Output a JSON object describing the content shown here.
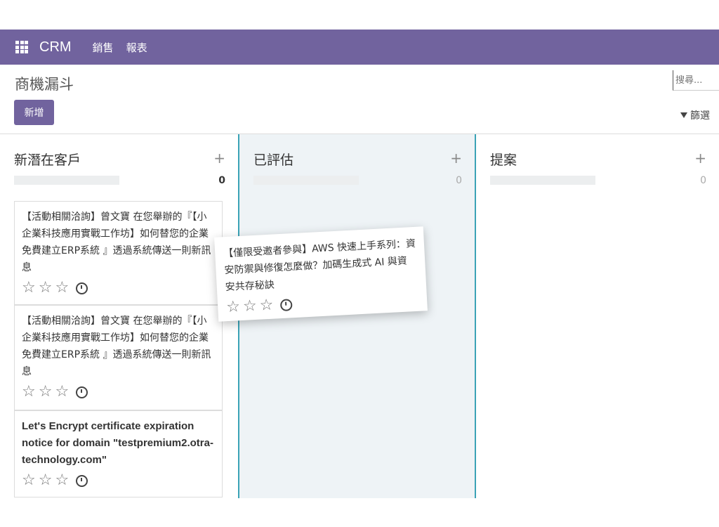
{
  "topbar": {
    "app_name": "CRM",
    "menu": [
      "銷售",
      "報表"
    ]
  },
  "control_panel": {
    "page_title": "商機漏斗",
    "new_button": "新增",
    "search_placeholder": "搜尋...",
    "filter_label": "篩選"
  },
  "columns": [
    {
      "title": "新潛在客戶",
      "count": "0"
    },
    {
      "title": "已評估",
      "count": "0"
    },
    {
      "title": "提案",
      "count": "0"
    }
  ],
  "cards": [
    {
      "title": "【活動相關洽詢】曾文寶 在您舉辦的『【小企業科技應用實戰工作坊】如何替您的企業免費建立ERP系統 』透過系統傳送一則新訊息"
    },
    {
      "title": "【活動相關洽詢】曾文寶 在您舉辦的『【小企業科技應用實戰工作坊】如何替您的企業免費建立ERP系統 』透過系統傳送一則新訊息"
    },
    {
      "title": "Let's Encrypt certificate expiration notice for domain \"testpremium2.otra-technology.com\""
    }
  ],
  "dragging_card": {
    "title": "【僅限受邀者參與】AWS 快速上手系列：資安防禦與修復怎麼做？加碼生成式 AI 與資安共存秘訣"
  },
  "icons": {
    "star": "star-outline-icon",
    "clock": "clock-icon",
    "apps": "apps-grid-icon",
    "filter": "filter-icon",
    "add": "plus-icon"
  },
  "colors": {
    "brand": "#71639e",
    "drop_column": "#3aa3b6"
  }
}
